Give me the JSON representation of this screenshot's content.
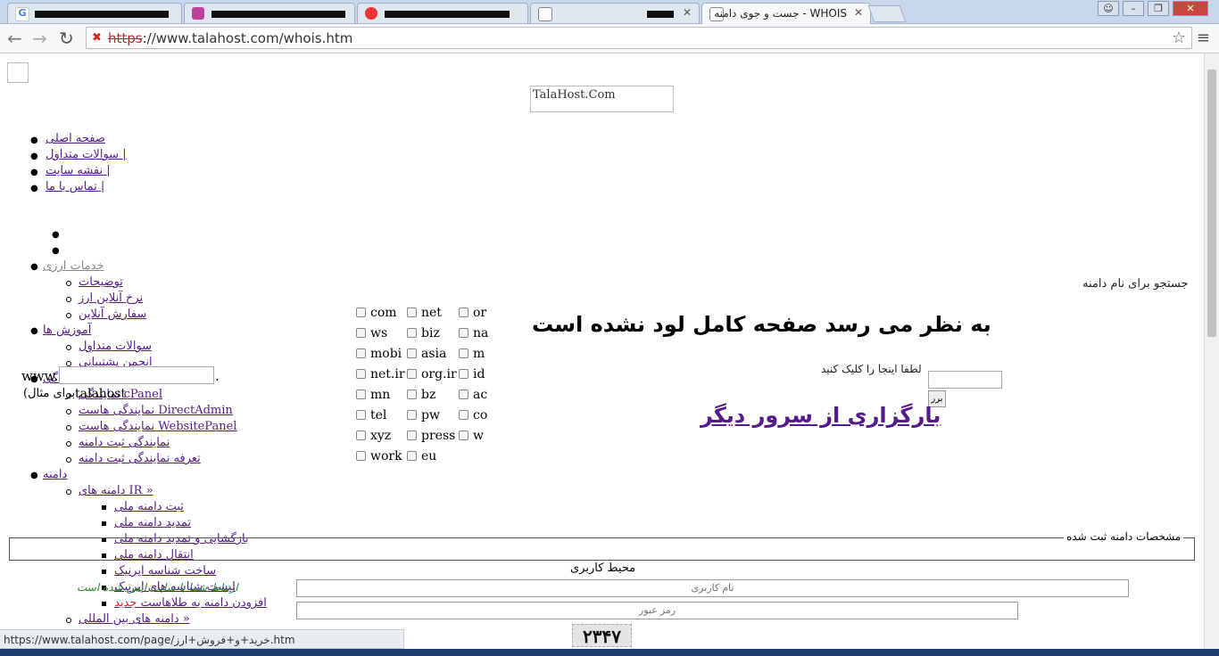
{
  "tabs": [
    {
      "title": "",
      "favicon": "google",
      "active": false
    },
    {
      "title": "",
      "favicon": "purple",
      "active": false
    },
    {
      "title": "",
      "favicon": "red",
      "active": false
    },
    {
      "title": "",
      "favicon": "doc",
      "active": false
    },
    {
      "title": "WHOIS - جست و جوی دامنه",
      "favicon": "doc",
      "active": true
    }
  ],
  "omnibox": {
    "protocol": "https",
    "rest": "://www.talahost.com/whois.htm"
  },
  "page": {
    "header_img_alt": "TalaHost.Com",
    "top_nav": [
      "صفحه اصلی",
      "سوالات متداول |",
      "نقشه سایت |",
      "تماس با ما |"
    ],
    "menu": {
      "currency": "خدمات ارزی",
      "currency_items": [
        "توضیحات",
        "نرخ آنلاین ارز",
        "سفارش آنلاین"
      ],
      "education": "آموزش ها",
      "education_items": [
        "سوالات متداول",
        "انجمن پشتیبانی"
      ],
      "reseller": "نمایندگی",
      "reseller_items": [
        "نمایندگی cPanel",
        "نمایندگی هاست DirectAdmin",
        "نمایندگی هاست WebsitePanel",
        "نمایندگی ثبت دامنه",
        "تعرفه نمایندگی ثبت دامنه"
      ],
      "domain": "دامنه",
      "ir_domains": "دامنه های IR  »",
      "ir_items": [
        "ثبت دامنه ملی",
        "تمدید دامنه ملی",
        "بازگشایی و تمدید دامنه ملی",
        "انتقال دامنه ملی",
        "ساخت شناسه ایرنیک",
        "لیست شناسه های ایرنیک",
        "افزودن دامنه به طلاهاست"
      ],
      "new_badge": "جدید",
      "intl_domains": "دامنه های بین المللی  »"
    },
    "search_label": "جستجو برای نام دامنه",
    "www_prefix": "www.",
    "www_suffix": ".",
    "example_text": "talahost",
    "example_suffix": "برای مثال)",
    "tlds": [
      "com",
      "net",
      "or",
      "ws",
      "biz",
      "na",
      "mobi",
      "asia",
      "m",
      "net.ir",
      "org.ir",
      "id",
      "mn",
      "bz",
      "ac",
      "tel",
      "pw",
      "co",
      "xyz",
      "press",
      "w",
      "work",
      "eu"
    ],
    "error_title": "به نظر می رسد صفحه کامل لود نشده است",
    "click_here": "لطفا اینجا را کلیک کنید",
    "reload_link": "بارگزاری از سرور دیگر",
    "search_btn": "برر",
    "registered_legend": "مشخصات دامنه ثبت شده",
    "user_area": "محیط کاربری",
    "username_placeholder": "نام کاربری",
    "password_placeholder": "رمز عبور",
    "secure_note": "ارتباط شما با سایت ایمن شده است",
    "captcha": "۲۳۴۷"
  },
  "status_url": "https://www.talahost.com/page/خرید+و+فروش+ارز.htm"
}
